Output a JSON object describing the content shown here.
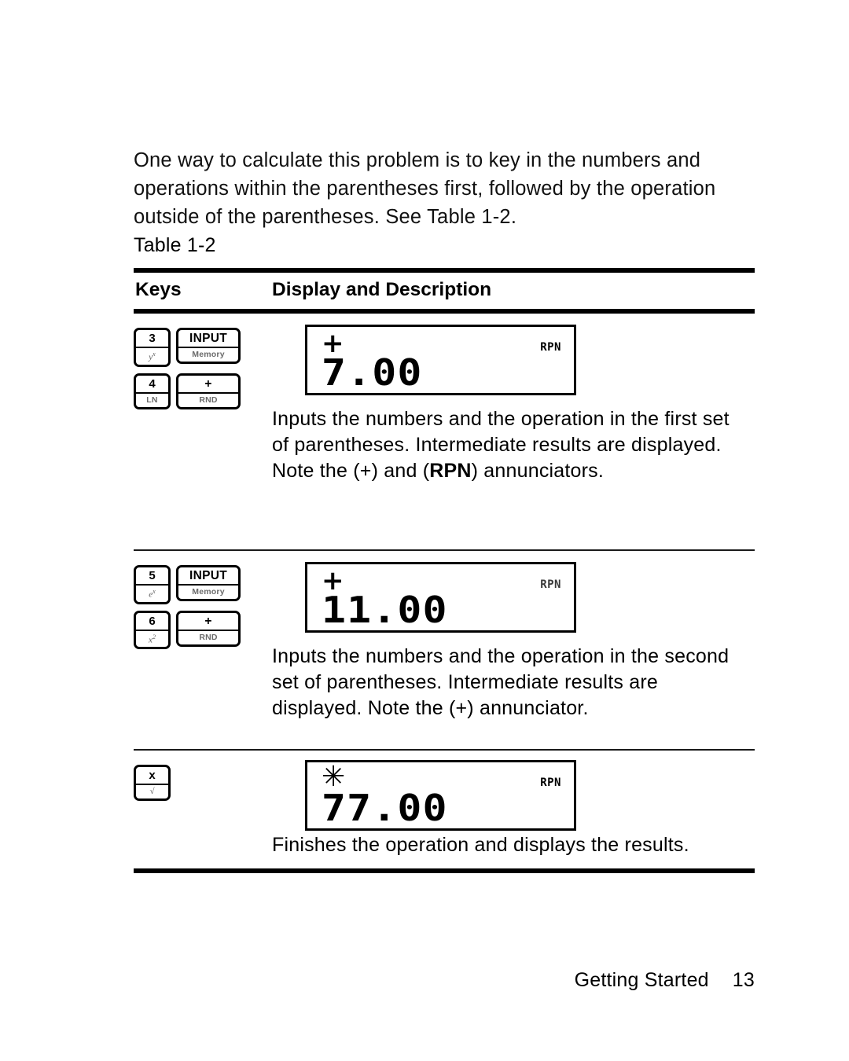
{
  "document": {
    "intro_paragraph": "One way to calculate this problem is to key in the numbers and operations within the parentheses first, followed by the operation outside of the parentheses. See Table 1-2.",
    "table_caption": "Table 1-2"
  },
  "table": {
    "headers": {
      "keys": "Keys",
      "display": "Display and Description"
    },
    "rows": [
      {
        "keys": [
          [
            {
              "top": "3",
              "sub": "y",
              "sup": "x",
              "style": "italic",
              "wide": false
            },
            {
              "top": "INPUT",
              "sub": "Memory",
              "sup": "",
              "style": "plain",
              "wide": true
            }
          ],
          [
            {
              "top": "4",
              "sub": "LN",
              "sup": "",
              "style": "plain",
              "wide": false
            },
            {
              "top": "+",
              "sub": "RND",
              "sup": "",
              "style": "plain",
              "wide": true
            }
          ]
        ],
        "display": {
          "annunciator": "+",
          "annunciator_name": "plus-annunciator",
          "rpn": "RPN",
          "rpn_faint": false,
          "value": "7.00"
        },
        "description_html": "Inputs the numbers and the operation in the first set of parentheses. Intermediate results are displayed. Note the (+) and (<b>RPN</b>) annunciators."
      },
      {
        "keys": [
          [
            {
              "top": "5",
              "sub": "e",
              "sup": "x",
              "style": "italic",
              "wide": false
            },
            {
              "top": "INPUT",
              "sub": "Memory",
              "sup": "",
              "style": "plain",
              "wide": true
            }
          ],
          [
            {
              "top": "6",
              "sub": "x",
              "sup": "2",
              "style": "italic",
              "wide": false
            },
            {
              "top": "+",
              "sub": "RND",
              "sup": "",
              "style": "plain",
              "wide": true
            }
          ]
        ],
        "display": {
          "annunciator": "+",
          "annunciator_name": "plus-annunciator",
          "rpn": "RPN",
          "rpn_faint": true,
          "value": "11.00"
        },
        "description_html": "Inputs the numbers and the operation in the second set of parentheses. Intermediate results are displayed. Note the (+) annunciator."
      },
      {
        "keys": [
          [
            {
              "top": "x",
              "sub": "√",
              "sup": "",
              "style": "italic",
              "wide": false
            }
          ]
        ],
        "display": {
          "annunciator": "✳",
          "annunciator_name": "multiply-annunciator",
          "rpn": "RPN",
          "rpn_faint": false,
          "value": "77.00"
        },
        "description_html": "Finishes the operation and displays the results."
      }
    ]
  },
  "footer": {
    "section": "Getting Started",
    "page_number": "13"
  },
  "colors": {
    "text": "#000000",
    "sublabel": "#5a5a5a",
    "rule": "#000000",
    "background": "#ffffff"
  }
}
